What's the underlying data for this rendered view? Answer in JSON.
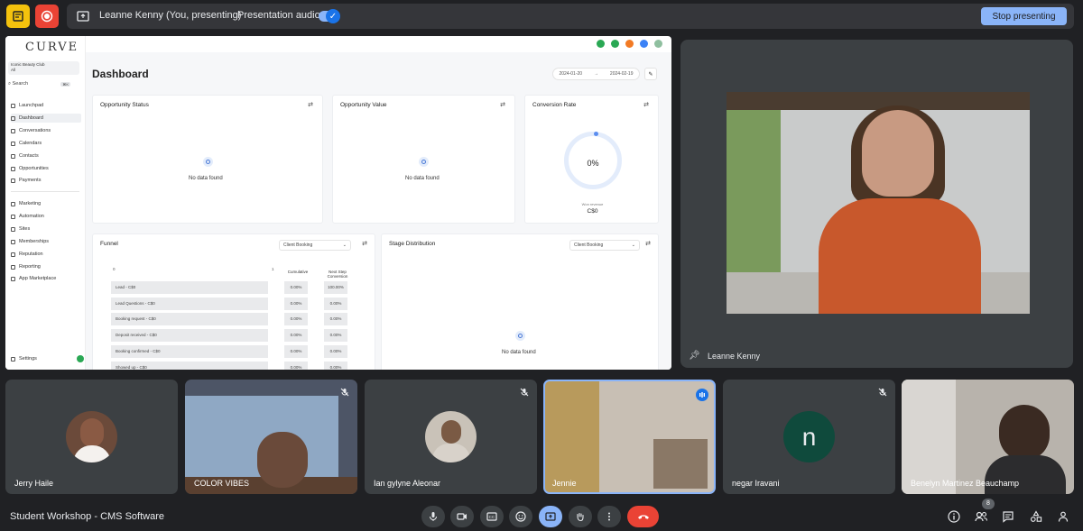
{
  "top_bar": {
    "presenter_label": "Leanne Kenny (You, presenting)",
    "audio_label": "Presentation audio",
    "audio_toggle": "on",
    "stop_button": "Stop presenting"
  },
  "shared_app": {
    "logo": "CURVE",
    "account": {
      "name": "Iconic Beauty Club",
      "sub": "All"
    },
    "search_placeholder": "Search",
    "search_shortcut": "⌘K",
    "nav_items": [
      {
        "label": "Launchpad"
      },
      {
        "label": "Dashboard"
      },
      {
        "label": "Conversations"
      },
      {
        "label": "Calendars"
      },
      {
        "label": "Contacts"
      },
      {
        "label": "Opportunities"
      },
      {
        "label": "Payments"
      }
    ],
    "nav_items_2": [
      {
        "label": "Marketing"
      },
      {
        "label": "Automation"
      },
      {
        "label": "Sites"
      },
      {
        "label": "Memberships"
      },
      {
        "label": "Reputation"
      },
      {
        "label": "Reporting"
      },
      {
        "label": "App Marketplace"
      }
    ],
    "settings_label": "Settings",
    "title": "Dashboard",
    "date_from": "2024-01-20",
    "date_to": "2024-02-19",
    "cards": {
      "opportunity_status": {
        "title": "Opportunity Status",
        "empty": "No data found"
      },
      "opportunity_value": {
        "title": "Opportunity Value",
        "empty": "No data found"
      },
      "conversion_rate": {
        "title": "Conversion Rate",
        "value": "0%",
        "won_label": "Won revenue",
        "won_value": "C$0"
      },
      "funnel": {
        "title": "Funnel",
        "select": "Client Booking",
        "axis_start": "0",
        "axis_end": "1",
        "col_cumulative": "Cumulative",
        "col_next": "Next Step Conversion",
        "rows": [
          {
            "label": "Lead - C$0",
            "cumulative": "0.00%",
            "next": "100.00%"
          },
          {
            "label": "Lead Questions - C$0",
            "cumulative": "0.00%",
            "next": "0.00%"
          },
          {
            "label": "Booking request - C$0",
            "cumulative": "0.00%",
            "next": "0.00%"
          },
          {
            "label": "Deposit received - C$0",
            "cumulative": "0.00%",
            "next": "0.00%"
          },
          {
            "label": "Booking confirmed - C$0",
            "cumulative": "0.00%",
            "next": "0.00%"
          },
          {
            "label": "Showed up - C$0",
            "cumulative": "0.00%",
            "next": "0.00%"
          }
        ]
      },
      "stage_distribution": {
        "title": "Stage Distribution",
        "select": "Client Booking",
        "empty": "No data found"
      }
    }
  },
  "pinned_tile": {
    "name": "Leanne Kenny"
  },
  "participants": [
    {
      "name": "Jerry Haile",
      "muted": false
    },
    {
      "name": "COLOR VIBES",
      "muted": true
    },
    {
      "name": "Ian gylyne Aleonar",
      "muted": true
    },
    {
      "name": "Jennie",
      "muted": false,
      "speaking": true
    },
    {
      "name": "negar Iravani",
      "muted": true,
      "initial": "n"
    },
    {
      "name": "Benelyn Martinez Beauchamp",
      "muted": false
    }
  ],
  "bottom_bar": {
    "meeting_title": "Student Workshop - CMS Software",
    "people_count": "8"
  },
  "colors": {
    "background": "#202124",
    "tile": "#3c4043",
    "accent": "#8ab4f8",
    "end_call": "#ea4335",
    "avatar_n": "#0f4a3c"
  }
}
